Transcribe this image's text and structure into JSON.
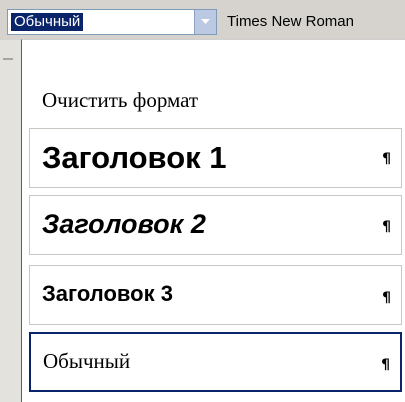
{
  "toolbar": {
    "style_value": "Обычный",
    "font_value": "Times New Roman"
  },
  "dropdown": {
    "items": [
      {
        "label": "Очистить формат",
        "mark": ""
      },
      {
        "label": "Заголовок 1",
        "mark": "¶"
      },
      {
        "label": "Заголовок 2",
        "mark": "¶"
      },
      {
        "label": "Заголовок 3",
        "mark": "¶"
      },
      {
        "label": "Обычный",
        "mark": "¶"
      }
    ],
    "selected_index": 4
  },
  "colors": {
    "selection": "#0a246a",
    "toolbar": "#d6d3ce"
  }
}
